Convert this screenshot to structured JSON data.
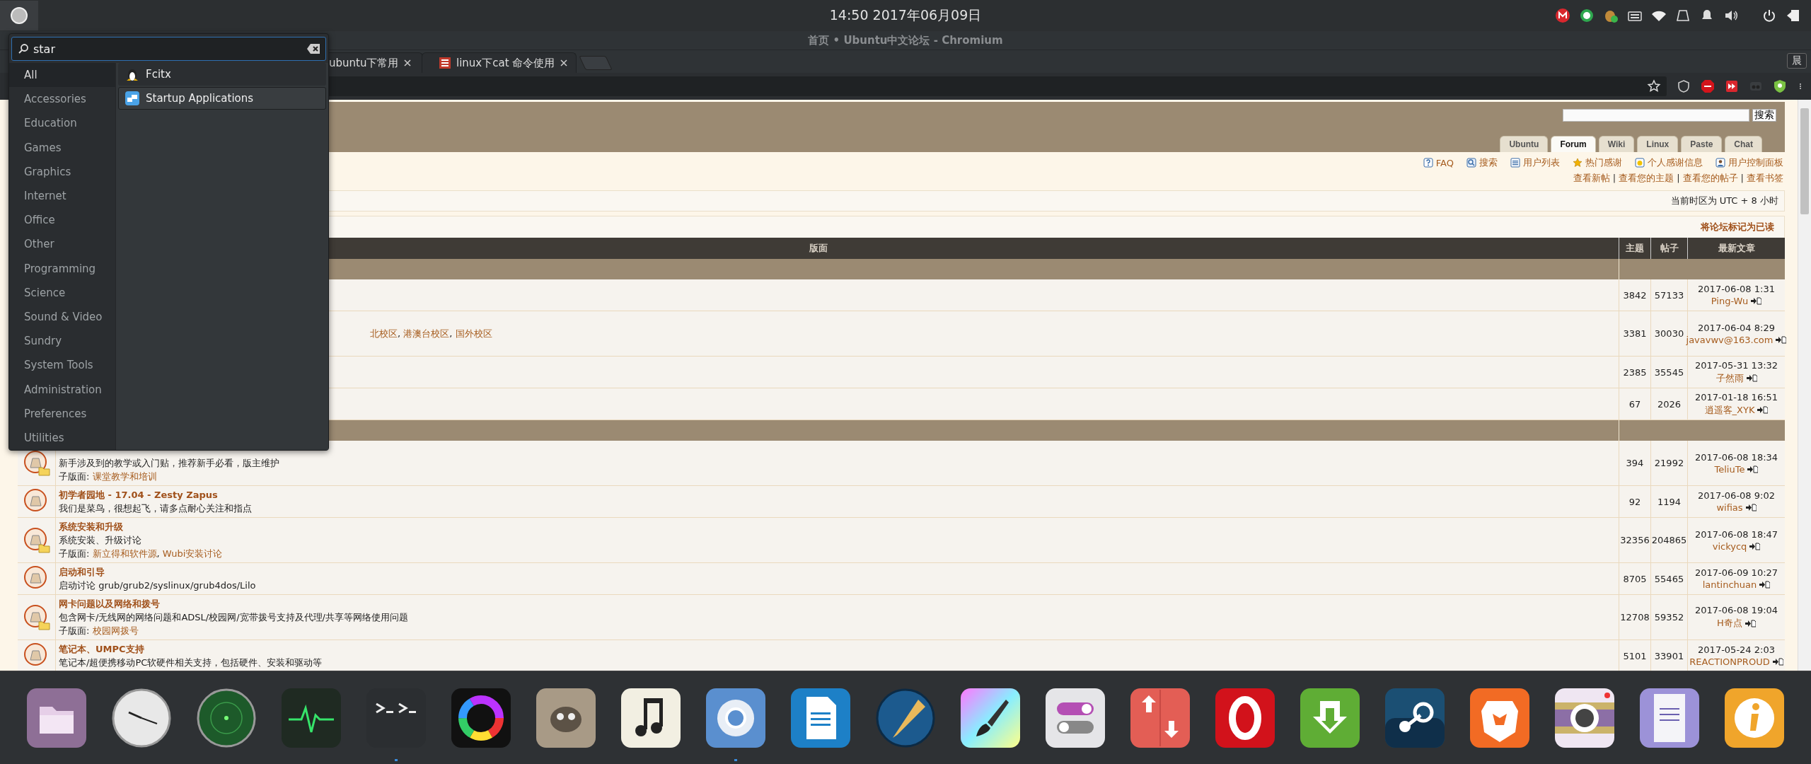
{
  "top_panel": {
    "clock": "14:50 2017年06月09日"
  },
  "browser": {
    "title": "首页 • Ubuntu中文论坛 - Chromium",
    "tabs": [
      {
        "label": "ubuntu下常用"
      },
      {
        "label": "linux下cat 命令使用"
      }
    ],
    "profile": "晨"
  },
  "forum": {
    "search_button": "搜索",
    "site_tabs": [
      {
        "label": "Ubuntu",
        "selected": false
      },
      {
        "label": "Forum",
        "selected": true
      },
      {
        "label": "Wiki",
        "selected": false
      },
      {
        "label": "Linux",
        "selected": false
      },
      {
        "label": "Paste",
        "selected": false
      },
      {
        "label": "Chat",
        "selected": false
      }
    ],
    "nav_links": [
      {
        "kind": "faq",
        "text": "FAQ"
      },
      {
        "kind": "search",
        "text": "搜索"
      },
      {
        "kind": "list",
        "text": "用户列表"
      },
      {
        "kind": "star",
        "text": "热门感谢"
      },
      {
        "kind": "thanks",
        "text": "个人感谢信息"
      },
      {
        "kind": "user",
        "text": "用户控制面板"
      }
    ],
    "user_links": [
      {
        "text": "查看新帖",
        "sep": "|"
      },
      {
        "text": "查看您的主题",
        "sep": "|"
      },
      {
        "text": "查看您的帖子",
        "sep": "|"
      },
      {
        "text": "查看书签"
      }
    ],
    "timezone": "当前时区为 UTC + 8 小时",
    "mark_read": "将论坛标记为已读",
    "columns": [
      "版面",
      "主题",
      "帖子",
      "最新文章"
    ],
    "sections": [
      {
        "forums": [
          {
            "kind": "covered",
            "topics": "3842",
            "posts": "57133",
            "last_date": "2017-06-08 1:31",
            "last_user": "Ping-Wu"
          },
          {
            "kind": "covered",
            "partial_links": [
              {
                "text": "北校区",
                "sep": ","
              },
              {
                "text": "港澳台校区",
                "sep": ","
              },
              {
                "text": "国外校区"
              }
            ],
            "topics": "3381",
            "posts": "30030",
            "last_date": "2017-06-04 8:29",
            "last_user": "javavwv@163.com"
          },
          {
            "kind": "covered",
            "topics": "2385",
            "posts": "35545",
            "last_date": "2017-05-31 13:32",
            "last_user": "子然雨"
          },
          {
            "kind": "covered",
            "topics": "67",
            "posts": "2026",
            "last_date": "2017-01-18 16:51",
            "last_user": "逍遥客_XYK"
          }
        ]
      },
      {
        "forums": [
          {
            "kind": "title_covered",
            "description": "新手涉及到的教学或入门贴，推荐新手必看，版主维护",
            "subforums": {
              "label": "子版面:",
              "links": [
                {
                  "text": "课堂教学和培训"
                }
              ]
            },
            "topics": "394",
            "posts": "21992",
            "last_date": "2017-06-08 18:34",
            "last_user": "TeliuTe"
          },
          {
            "kind": "forum",
            "title": "初学者园地 - 17.04 - Zesty Zapus",
            "description": "我们是菜鸟，很想起飞，请多点耐心关注和指点",
            "topics": "92",
            "posts": "1194",
            "last_date": "2017-06-08 9:02",
            "last_user": "wifias"
          },
          {
            "kind": "forum",
            "title": "系统安装和升级",
            "description": "系统安装、升级讨论",
            "subforums": {
              "label": "子版面:",
              "links": [
                {
                  "text": "新立得和软件源",
                  "sep": ","
                },
                {
                  "text": "Wubi安装讨论"
                }
              ]
            },
            "topics": "32356",
            "posts": "204865",
            "last_date": "2017-06-08 18:47",
            "last_user": "vickycq"
          },
          {
            "kind": "forum",
            "title": "启动和引导",
            "description": "启动讨论 grub/grub2/syslinux/grub4dos/Lilo",
            "topics": "8705",
            "posts": "55465",
            "last_date": "2017-06-09 10:27",
            "last_user": "lantinchuan"
          },
          {
            "kind": "forum",
            "title": "网卡问题以及网络和拨号",
            "description": "包含网卡/无线网的网络问题和ADSL/校园网/宽带拨号支持及代理/共享等网络使用问题",
            "subforums": {
              "label": "子版面:",
              "links": [
                {
                  "text": "校园网拨号"
                }
              ]
            },
            "topics": "12708",
            "posts": "59352",
            "last_date": "2017-06-08 19:04",
            "last_user": "H奇点"
          },
          {
            "kind": "forum",
            "title": "笔记本、UMPC支持",
            "description": "笔记本/超便携移动PC软硬件相关支持，包括硬件、安装和驱动等",
            "topics": "5101",
            "posts": "33901",
            "last_date": "2017-05-24 2:03",
            "last_user": "REACTIONPROUD"
          }
        ]
      }
    ]
  },
  "launcher": {
    "search": {
      "value": "star"
    },
    "categories": [
      {
        "label": "All",
        "selected": true
      },
      {
        "label": "Accessories",
        "selected": false
      },
      {
        "label": "Education",
        "selected": false
      },
      {
        "label": "Games",
        "selected": false
      },
      {
        "label": "Graphics",
        "selected": false
      },
      {
        "label": "Internet",
        "selected": false
      },
      {
        "label": "Office",
        "selected": false
      },
      {
        "label": "Other",
        "selected": false
      },
      {
        "label": "Programming",
        "selected": false
      },
      {
        "label": "Science",
        "selected": false
      },
      {
        "label": "Sound & Video",
        "selected": false
      },
      {
        "label": "Sundry",
        "selected": false
      },
      {
        "label": "System Tools",
        "selected": false
      },
      {
        "label": "Administration",
        "selected": false
      },
      {
        "label": "Preferences",
        "selected": false
      },
      {
        "label": "Utilities",
        "selected": false
      }
    ],
    "results": [
      {
        "kind": "penguin",
        "label": "Fcitx",
        "selected": false
      },
      {
        "kind": "startup",
        "label": "Startup Applications",
        "selected": true
      }
    ]
  },
  "dock": [
    {
      "kind": "files",
      "running": false
    },
    {
      "kind": "clock",
      "running": false
    },
    {
      "kind": "radar",
      "running": false
    },
    {
      "kind": "monitor",
      "running": false
    },
    {
      "kind": "terminal",
      "running": true
    },
    {
      "kind": "colorwheel",
      "running": false
    },
    {
      "kind": "gimp",
      "running": false
    },
    {
      "kind": "music",
      "running": false
    },
    {
      "kind": "chromium",
      "running": true
    },
    {
      "kind": "writer",
      "running": false
    },
    {
      "kind": "pen",
      "running": false
    },
    {
      "kind": "paint",
      "running": false
    },
    {
      "kind": "toggles",
      "running": false
    },
    {
      "kind": "updown",
      "running": false
    },
    {
      "kind": "opera",
      "running": false
    },
    {
      "kind": "download",
      "running": false
    },
    {
      "kind": "steam",
      "running": false
    },
    {
      "kind": "lion",
      "running": false
    },
    {
      "kind": "camera",
      "running": false
    },
    {
      "kind": "notes",
      "running": false
    },
    {
      "kind": "info",
      "running": false
    }
  ]
}
